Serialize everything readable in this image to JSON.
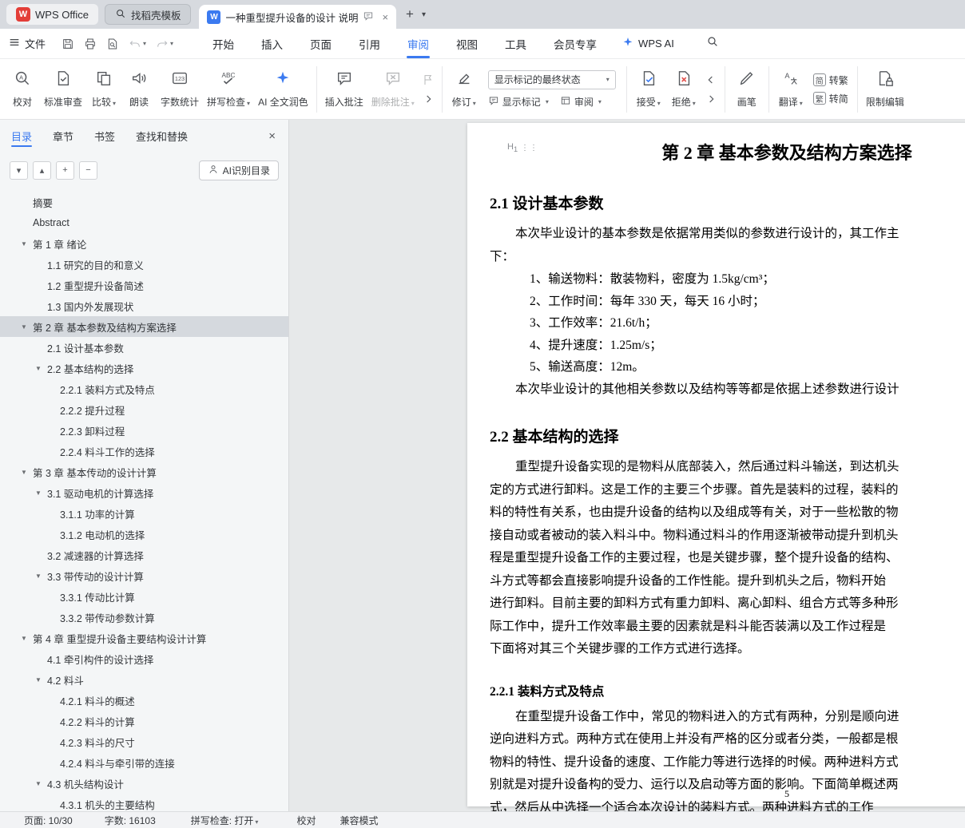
{
  "titlebar": {
    "home": "WPS Office",
    "template_tab": "找稻壳模板",
    "doc_tab": "一种重型提升设备的设计 说明"
  },
  "menubar": {
    "file": "文件",
    "tabs": [
      "开始",
      "插入",
      "页面",
      "引用",
      "审阅",
      "视图",
      "工具",
      "会员专享"
    ],
    "active_tab": "审阅",
    "wps_ai": "WPS AI"
  },
  "ribbon": {
    "proofread": "校对",
    "standard_review": "标准审查",
    "compare": "比较",
    "read_aloud": "朗读",
    "word_count": "字数统计",
    "spell_check": "拼写检查",
    "ai_polish": "AI 全文润色",
    "insert_comment": "插入批注",
    "delete_comment": "删除批注",
    "track_changes": "修订",
    "markup_state_dropdown": "显示标记的最终状态",
    "show_markup": "显示标记",
    "review_pane": "审阅",
    "accept": "接受",
    "reject": "拒绝",
    "brush": "画笔",
    "translate": "翻译",
    "s2t_icon": "简",
    "s2t": "转繁",
    "t2s_icon": "繁",
    "t2s": "转简",
    "restrict_edit": "限制编辑"
  },
  "sidebar": {
    "tabs": [
      "目录",
      "章节",
      "书签",
      "查找和替换"
    ],
    "active_tab": "目录",
    "ai_recognize": "AI识别目录",
    "toc": [
      {
        "label": "摘要",
        "level": 0,
        "arrow": false
      },
      {
        "label": "Abstract",
        "level": 0,
        "arrow": false
      },
      {
        "label": "第 1 章 绪论",
        "level": 0,
        "arrow": true
      },
      {
        "label": "1.1 研究的目的和意义",
        "level": 1,
        "arrow": false
      },
      {
        "label": "1.2 重型提升设备简述",
        "level": 1,
        "arrow": false
      },
      {
        "label": "1.3 国内外发展现状",
        "level": 1,
        "arrow": false
      },
      {
        "label": "第 2 章 基本参数及结构方案选择",
        "level": 0,
        "arrow": true,
        "selected": true
      },
      {
        "label": "2.1 设计基本参数",
        "level": 1,
        "arrow": false
      },
      {
        "label": "2.2 基本结构的选择",
        "level": 1,
        "arrow": true
      },
      {
        "label": "2.2.1 装料方式及特点",
        "level": 2,
        "arrow": false
      },
      {
        "label": "2.2.2 提升过程",
        "level": 2,
        "arrow": false
      },
      {
        "label": "2.2.3 卸料过程",
        "level": 2,
        "arrow": false
      },
      {
        "label": "2.2.4 料斗工作的选择",
        "level": 2,
        "arrow": false
      },
      {
        "label": "第 3 章 基本传动的设计计算",
        "level": 0,
        "arrow": true
      },
      {
        "label": "3.1 驱动电机的计算选择",
        "level": 1,
        "arrow": true
      },
      {
        "label": "3.1.1 功率的计算",
        "level": 2,
        "arrow": false
      },
      {
        "label": "3.1.2 电动机的选择",
        "level": 2,
        "arrow": false
      },
      {
        "label": "3.2 减速器的计算选择",
        "level": 1,
        "arrow": false
      },
      {
        "label": "3.3 带传动的设计计算",
        "level": 1,
        "arrow": true
      },
      {
        "label": "3.3.1 传动比计算",
        "level": 2,
        "arrow": false
      },
      {
        "label": "3.3.2 带传动参数计算",
        "level": 2,
        "arrow": false
      },
      {
        "label": "第 4 章 重型提升设备主要结构设计计算",
        "level": 0,
        "arrow": true
      },
      {
        "label": "4.1 牵引构件的设计选择",
        "level": 1,
        "arrow": false
      },
      {
        "label": "4.2 料斗",
        "level": 1,
        "arrow": true
      },
      {
        "label": "4.2.1 料斗的概述",
        "level": 2,
        "arrow": false
      },
      {
        "label": "4.2.2 料斗的计算",
        "level": 2,
        "arrow": false
      },
      {
        "label": "4.2.3 料斗的尺寸",
        "level": 2,
        "arrow": false
      },
      {
        "label": "4.2.4 料斗与牵引带的连接",
        "level": 2,
        "arrow": false
      },
      {
        "label": "4.3 机头结构设计",
        "level": 1,
        "arrow": true
      },
      {
        "label": "4.3.1 机头的主要结构",
        "level": 2,
        "arrow": false
      }
    ]
  },
  "document": {
    "title": "第 2 章 基本参数及结构方案选择",
    "page_number": "5",
    "blocks": [
      {
        "type": "h2",
        "text": "2.1 设计基本参数"
      },
      {
        "type": "p",
        "lines": [
          {
            "t": "本次毕业设计的基本参数是依据常用类似的参数进行设计的，其工作主",
            "indent": true
          },
          {
            "t": "下：",
            "indent": false
          }
        ]
      },
      {
        "type": "list",
        "items": [
          "1、输送物料：散装物料，密度为 1.5kg/cm³；",
          "2、工作时间：每年 330 天，每天 16 小时；",
          "3、工作效率：21.6t/h；",
          "4、提升速度：1.25m/s；",
          "5、输送高度：12m。"
        ]
      },
      {
        "type": "p",
        "lines": [
          {
            "t": "本次毕业设计的其他相关参数以及结构等等都是依据上述参数进行设计",
            "indent": true
          }
        ]
      },
      {
        "type": "h2",
        "text": "2.2 基本结构的选择"
      },
      {
        "type": "p",
        "lines": [
          {
            "t": "重型提升设备实现的是物料从底部装入，然后通过料斗输送，到达机头",
            "indent": true
          },
          {
            "t": "定的方式进行卸料。这是工作的主要三个步骤。首先是装料的过程，装料的",
            "indent": false
          },
          {
            "t": "料的特性有关系，也由提升设备的结构以及组成等有关，对于一些松散的物",
            "indent": false
          },
          {
            "t": "接自动或者被动的装入料斗中。物料通过料斗的作用逐渐被带动提升到机头",
            "indent": false
          },
          {
            "t": "程是重型提升设备工作的主要过程，也是关键步骤，整个提升设备的结构、",
            "indent": false
          },
          {
            "t": "斗方式等都会直接影响提升设备的工作性能。提升到机头之后，物料开始",
            "indent": false
          },
          {
            "t": "进行卸料。目前主要的卸料方式有重力卸料、离心卸料、组合方式等多种形",
            "indent": false
          },
          {
            "t": "际工作中，提升工作效率最主要的因素就是料斗能否装满以及工作过程是",
            "indent": false
          },
          {
            "t": "下面将对其三个关键步骤的工作方式进行选择。",
            "indent": false
          }
        ]
      },
      {
        "type": "h3",
        "text": "2.2.1 装料方式及特点"
      },
      {
        "type": "p",
        "lines": [
          {
            "t": "在重型提升设备工作中，常见的物料进入的方式有两种，分别是顺向进",
            "indent": true
          },
          {
            "t": "逆向进料方式。两种方式在使用上并没有严格的区分或者分类，一般都是根",
            "indent": false
          },
          {
            "t": "物料的特性、提升设备的速度、工作能力等进行选择的时候。两种进料方式",
            "indent": false
          },
          {
            "t": "别就是对提升设备构的受力、运行以及启动等方面的影响。下面简单概述两",
            "indent": false
          },
          {
            "t": "式，然后从中选择一个适合本次设计的装料方式。两种进料方式的工作",
            "indent": false
          }
        ]
      }
    ]
  },
  "statusbar": {
    "page": "页面: 10/30",
    "words": "字数: 16103",
    "spell": "拼写检查: 打开",
    "proof": "校对",
    "mode": "兼容模式"
  }
}
